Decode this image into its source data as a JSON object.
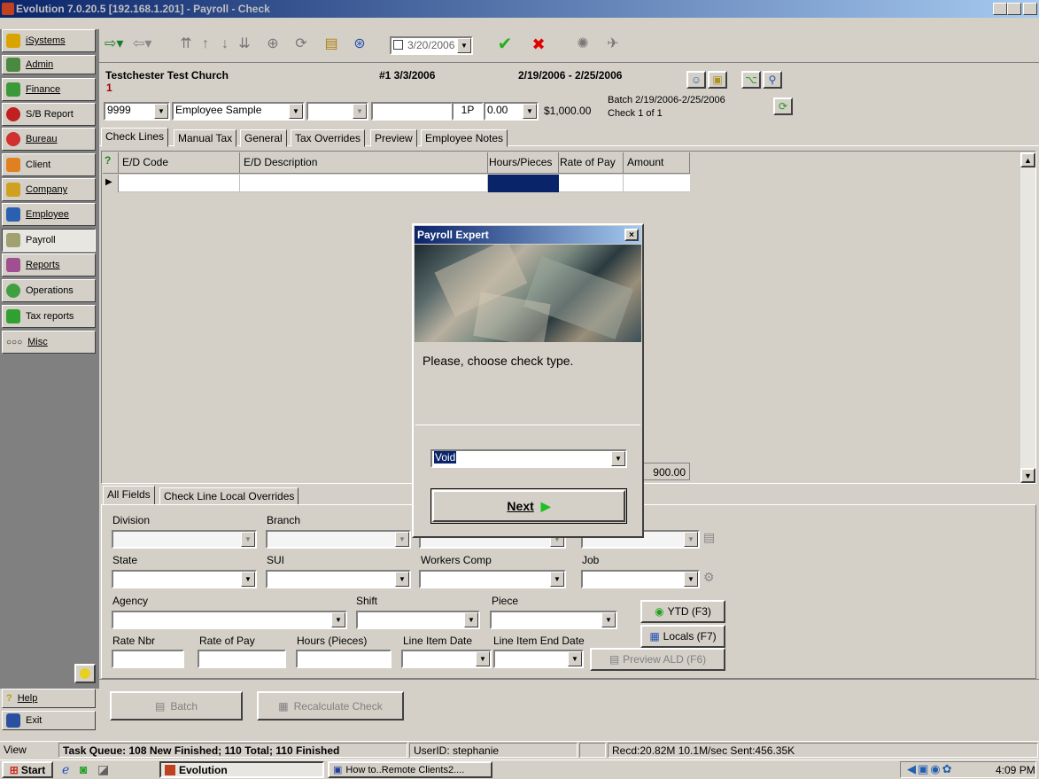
{
  "window": {
    "title": "Evolution 7.0.20.5 [192.168.1.201] - Payroll - Check"
  },
  "sidebar": {
    "items": [
      {
        "label": "iSystems"
      },
      {
        "label": "Admin"
      },
      {
        "label": "Finance"
      },
      {
        "label": "S/B Report"
      },
      {
        "label": "Bureau"
      },
      {
        "label": "Client"
      },
      {
        "label": "Company"
      },
      {
        "label": "Employee"
      },
      {
        "label": "Payroll"
      },
      {
        "label": "Reports"
      },
      {
        "label": "Operations"
      },
      {
        "label": "Tax reports"
      },
      {
        "label": "Misc"
      }
    ],
    "help": "Help",
    "exit": "Exit",
    "view": "View"
  },
  "toolbar": {
    "date": "3/20/2006",
    "check_icon": "✔",
    "cancel_icon": "✖"
  },
  "header": {
    "company": "Testchester Test Church",
    "check_no": "#1 3/3/2006",
    "period": "2/19/2006 - 2/25/2006",
    "red_count": "1",
    "emp_number": "9999",
    "emp_name": "Employee Sample",
    "freq": "1P",
    "hours": "0.00",
    "amount": "$1,000.00",
    "batch": "Batch 2/19/2006-2/25/2006",
    "check_of": "Check 1 of 1"
  },
  "tabs": [
    "Check Lines",
    "Manual Tax",
    "General",
    "Tax Overrides",
    "Preview",
    "Employee Notes"
  ],
  "grid": {
    "columns": [
      "E/D Code",
      "E/D Description",
      "Hours/Pieces",
      "Rate of Pay",
      "Amount"
    ],
    "total": "900.00"
  },
  "lower_tabs": [
    "All Fields",
    "Check Line Local Overrides"
  ],
  "fields": {
    "division": "Division",
    "branch": "Branch",
    "state": "State",
    "sui": "SUI",
    "workers_comp": "Workers Comp",
    "job": "Job",
    "agency": "Agency",
    "shift": "Shift",
    "piece": "Piece",
    "rate_nbr": "Rate Nbr",
    "rate_of_pay": "Rate of Pay",
    "hours_pieces": "Hours (Pieces)",
    "line_item_date": "Line Item Date",
    "line_item_end_date": "Line Item End Date"
  },
  "buttons": {
    "ytd": "YTD (F3)",
    "locals": "Locals (F7)",
    "preview_ald": "Preview ALD (F6)",
    "batch": "Batch",
    "recalc": "Recalculate Check"
  },
  "dialog": {
    "title": "Payroll Expert",
    "prompt": "Please, choose check type.",
    "selected": "Void",
    "next": "Next"
  },
  "statusbar": {
    "queue": "Task Queue: 108 New Finished; 110 Total; 110 Finished",
    "user": "UserID: stephanie",
    "net": "Recd:20.82M 10.1M/sec  Sent:456.35K"
  },
  "taskbar": {
    "start": "Start",
    "app1": "Evolution",
    "app2": "How to..Remote Clients2....",
    "time": "4:09 PM"
  }
}
